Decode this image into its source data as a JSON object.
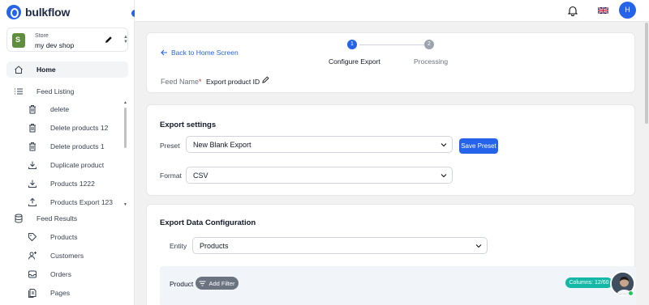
{
  "app": {
    "name": "bulkflow"
  },
  "store": {
    "label": "Store",
    "name": "my dev shop"
  },
  "sidebar": {
    "items": [
      {
        "label": "Home",
        "icon": "home-icon",
        "active": true
      },
      {
        "label": "Feed Listing",
        "icon": "list-icon"
      },
      {
        "label": "delete",
        "icon": "trash-icon"
      },
      {
        "label": "Delete products 12",
        "icon": "trash-icon"
      },
      {
        "label": "Delete products 1",
        "icon": "trash-icon"
      },
      {
        "label": "Duplicate product",
        "icon": "download-icon"
      },
      {
        "label": "Products 1222",
        "icon": "download-icon"
      },
      {
        "label": "Products Export 123",
        "icon": "upload-icon"
      },
      {
        "label": "Feed Results",
        "icon": "database-icon"
      },
      {
        "label": "Products",
        "icon": "tag-icon"
      },
      {
        "label": "Customers",
        "icon": "user-plus-icon"
      },
      {
        "label": "Orders",
        "icon": "inbox-icon"
      },
      {
        "label": "Pages",
        "icon": "pages-icon"
      }
    ]
  },
  "topbar": {
    "avatar_initial": "H",
    "language": "English (UK)"
  },
  "header": {
    "back_label": "Back to Home Screen",
    "steps": [
      {
        "number": "1",
        "label": "Configure Export",
        "active": true
      },
      {
        "number": "2",
        "label": "Processing",
        "active": false
      }
    ],
    "feed_name_label": "Feed Name",
    "feed_name_required": "*",
    "feed_name_value": "Export product ID"
  },
  "export_settings": {
    "title": "Export settings",
    "preset_label": "Preset",
    "preset_value": "New Blank Export",
    "save_preset_label": "Save Preset",
    "format_label": "Format",
    "format_value": "CSV"
  },
  "data_config": {
    "title": "Export Data Configuration",
    "entity_label": "Entity",
    "entity_value": "Products",
    "product_label": "Product",
    "add_filter_label": "Add Filter",
    "columns_badge": "Columns: 12/60"
  },
  "colors": {
    "accent": "#2563eb",
    "badge": "#14b8a6",
    "required": "#dc2626"
  }
}
